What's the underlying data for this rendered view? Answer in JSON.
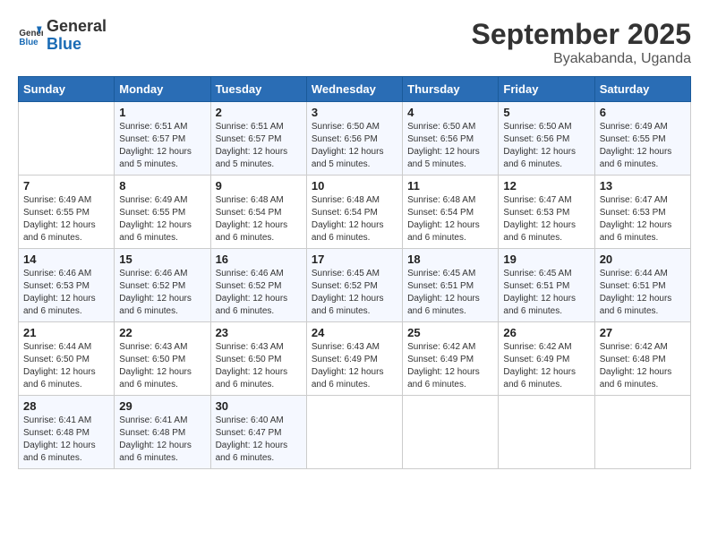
{
  "header": {
    "logo_line1": "General",
    "logo_line2": "Blue",
    "month_title": "September 2025",
    "subtitle": "Byakabanda, Uganda"
  },
  "days_of_week": [
    "Sunday",
    "Monday",
    "Tuesday",
    "Wednesday",
    "Thursday",
    "Friday",
    "Saturday"
  ],
  "weeks": [
    [
      {
        "day": "",
        "info": ""
      },
      {
        "day": "1",
        "info": "Sunrise: 6:51 AM\nSunset: 6:57 PM\nDaylight: 12 hours and 5 minutes."
      },
      {
        "day": "2",
        "info": "Sunrise: 6:51 AM\nSunset: 6:57 PM\nDaylight: 12 hours and 5 minutes."
      },
      {
        "day": "3",
        "info": "Sunrise: 6:50 AM\nSunset: 6:56 PM\nDaylight: 12 hours and 5 minutes."
      },
      {
        "day": "4",
        "info": "Sunrise: 6:50 AM\nSunset: 6:56 PM\nDaylight: 12 hours and 5 minutes."
      },
      {
        "day": "5",
        "info": "Sunrise: 6:50 AM\nSunset: 6:56 PM\nDaylight: 12 hours and 6 minutes."
      },
      {
        "day": "6",
        "info": "Sunrise: 6:49 AM\nSunset: 6:55 PM\nDaylight: 12 hours and 6 minutes."
      }
    ],
    [
      {
        "day": "7",
        "info": "Sunrise: 6:49 AM\nSunset: 6:55 PM\nDaylight: 12 hours and 6 minutes."
      },
      {
        "day": "8",
        "info": "Sunrise: 6:49 AM\nSunset: 6:55 PM\nDaylight: 12 hours and 6 minutes."
      },
      {
        "day": "9",
        "info": "Sunrise: 6:48 AM\nSunset: 6:54 PM\nDaylight: 12 hours and 6 minutes."
      },
      {
        "day": "10",
        "info": "Sunrise: 6:48 AM\nSunset: 6:54 PM\nDaylight: 12 hours and 6 minutes."
      },
      {
        "day": "11",
        "info": "Sunrise: 6:48 AM\nSunset: 6:54 PM\nDaylight: 12 hours and 6 minutes."
      },
      {
        "day": "12",
        "info": "Sunrise: 6:47 AM\nSunset: 6:53 PM\nDaylight: 12 hours and 6 minutes."
      },
      {
        "day": "13",
        "info": "Sunrise: 6:47 AM\nSunset: 6:53 PM\nDaylight: 12 hours and 6 minutes."
      }
    ],
    [
      {
        "day": "14",
        "info": "Sunrise: 6:46 AM\nSunset: 6:53 PM\nDaylight: 12 hours and 6 minutes."
      },
      {
        "day": "15",
        "info": "Sunrise: 6:46 AM\nSunset: 6:52 PM\nDaylight: 12 hours and 6 minutes."
      },
      {
        "day": "16",
        "info": "Sunrise: 6:46 AM\nSunset: 6:52 PM\nDaylight: 12 hours and 6 minutes."
      },
      {
        "day": "17",
        "info": "Sunrise: 6:45 AM\nSunset: 6:52 PM\nDaylight: 12 hours and 6 minutes."
      },
      {
        "day": "18",
        "info": "Sunrise: 6:45 AM\nSunset: 6:51 PM\nDaylight: 12 hours and 6 minutes."
      },
      {
        "day": "19",
        "info": "Sunrise: 6:45 AM\nSunset: 6:51 PM\nDaylight: 12 hours and 6 minutes."
      },
      {
        "day": "20",
        "info": "Sunrise: 6:44 AM\nSunset: 6:51 PM\nDaylight: 12 hours and 6 minutes."
      }
    ],
    [
      {
        "day": "21",
        "info": "Sunrise: 6:44 AM\nSunset: 6:50 PM\nDaylight: 12 hours and 6 minutes."
      },
      {
        "day": "22",
        "info": "Sunrise: 6:43 AM\nSunset: 6:50 PM\nDaylight: 12 hours and 6 minutes."
      },
      {
        "day": "23",
        "info": "Sunrise: 6:43 AM\nSunset: 6:50 PM\nDaylight: 12 hours and 6 minutes."
      },
      {
        "day": "24",
        "info": "Sunrise: 6:43 AM\nSunset: 6:49 PM\nDaylight: 12 hours and 6 minutes."
      },
      {
        "day": "25",
        "info": "Sunrise: 6:42 AM\nSunset: 6:49 PM\nDaylight: 12 hours and 6 minutes."
      },
      {
        "day": "26",
        "info": "Sunrise: 6:42 AM\nSunset: 6:49 PM\nDaylight: 12 hours and 6 minutes."
      },
      {
        "day": "27",
        "info": "Sunrise: 6:42 AM\nSunset: 6:48 PM\nDaylight: 12 hours and 6 minutes."
      }
    ],
    [
      {
        "day": "28",
        "info": "Sunrise: 6:41 AM\nSunset: 6:48 PM\nDaylight: 12 hours and 6 minutes."
      },
      {
        "day": "29",
        "info": "Sunrise: 6:41 AM\nSunset: 6:48 PM\nDaylight: 12 hours and 6 minutes."
      },
      {
        "day": "30",
        "info": "Sunrise: 6:40 AM\nSunset: 6:47 PM\nDaylight: 12 hours and 6 minutes."
      },
      {
        "day": "",
        "info": ""
      },
      {
        "day": "",
        "info": ""
      },
      {
        "day": "",
        "info": ""
      },
      {
        "day": "",
        "info": ""
      }
    ]
  ]
}
